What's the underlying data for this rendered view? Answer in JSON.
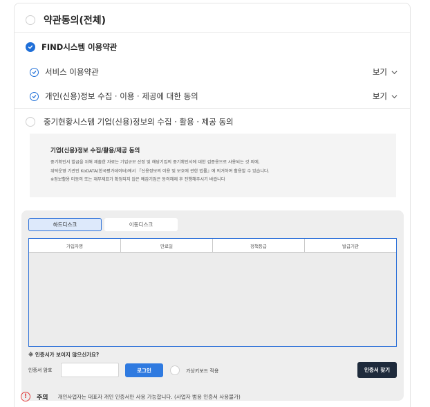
{
  "terms": {
    "all_label": "약관동의(전체)",
    "find_label": "FIND시스템 이용약관",
    "items": [
      {
        "label": "서비스 이용약관",
        "view": "보기"
      },
      {
        "label": "개인(신용)정보 수집 · 이용 · 제공에 대한 동의",
        "view": "보기"
      }
    ],
    "kbh_label": "중기현황시스템 기업(신용)정보의 수집 · 활용 · 제공 동의"
  },
  "notice": {
    "title": "기업(신용)정보 수집/활용/제공 동의",
    "lines": [
      "중기확인서 발급을 위해 제출한 자료는 기업규모 산정 및 해당기업의 중기확인서에 대한 검증용으로 사용되는 것 외에,",
      "위탁운영 기관인 KoDATA(한국평가데이터)에서 『신용정보의 이용 및 보호에 관한 법률』에 의거하여 활용할 수 있습니다.",
      "※정보활용 미동의 또는 재무제표가 확정되지 않은 예갑기업은 동의해제 후 진행해주시기 바랍니다"
    ]
  },
  "cert": {
    "tabs": [
      "하드디스크",
      "이동디스크"
    ],
    "columns": [
      "가입자명",
      "만료일",
      "정책등급",
      "발급기관"
    ],
    "help_text": "※ 인증서가 보이지 않으신가요?",
    "password_label": "인증서 암호",
    "password_value": "",
    "login_label": "로그인",
    "virtual_keyboard_label": "가상키보드 적용",
    "find_cert_label": "인증서 찾기"
  },
  "caution": {
    "title": "주의",
    "text": "개인사업자는 대표자 개인 인증서만 사용 가능합니다. (사업자 범용 인증서 사용불가)"
  },
  "colors": {
    "accent": "#1f6fd8",
    "dark_button": "#1e2a3b",
    "warning": "#e03a3a"
  }
}
